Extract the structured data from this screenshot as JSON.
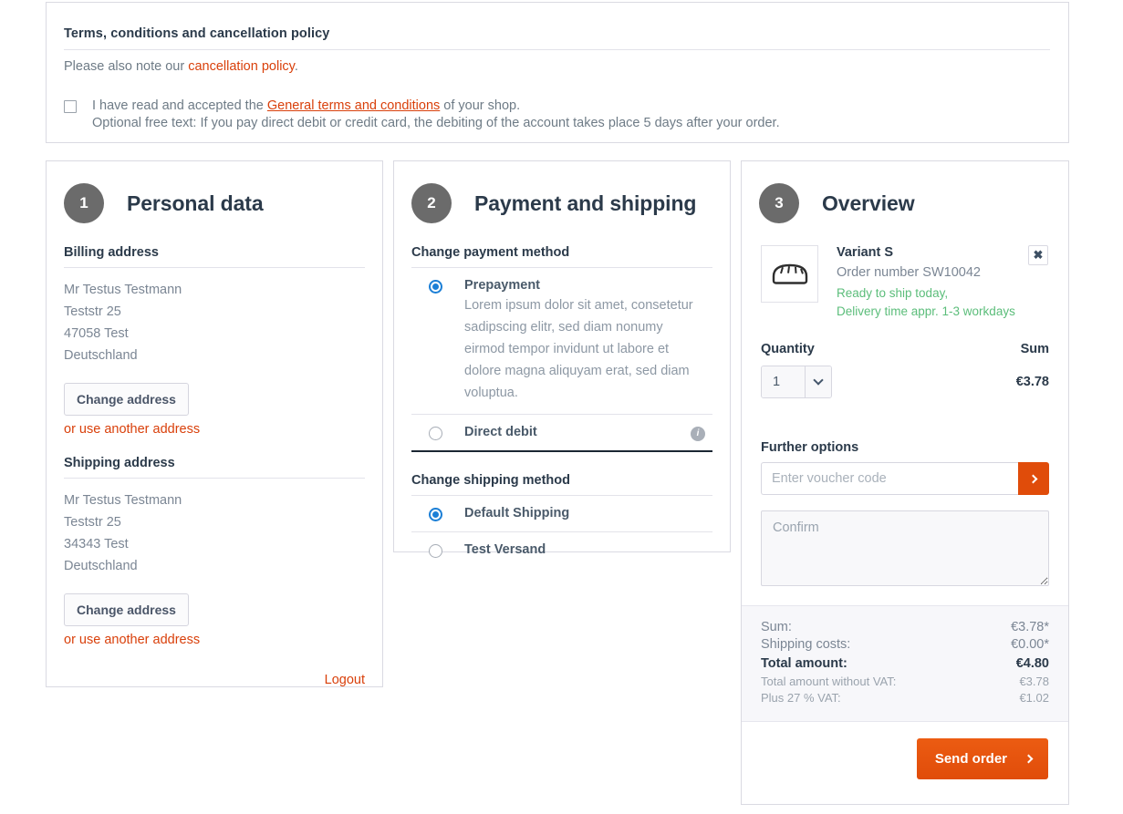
{
  "terms": {
    "title": "Terms, conditions and cancellation policy",
    "note_prefix": "Please also note our ",
    "note_link": "cancellation policy",
    "note_suffix": ".",
    "accept_prefix": "I have read and accepted the ",
    "accept_link": "General terms and conditions",
    "accept_suffix": " of your shop.",
    "optional_text": "Optional free text: If you pay direct debit or credit card, the debiting of the account takes place 5 days after your order.",
    "checkbox_checked": false
  },
  "personal": {
    "step": "1",
    "title": "Personal data",
    "billing_heading": "Billing address",
    "billing_lines": [
      "Mr Testus Testmann",
      "Teststr 25",
      "47058 Test",
      "Deutschland"
    ],
    "billing_change_label": "Change address",
    "billing_alt_label": "or use another address",
    "shipping_heading": "Shipping address",
    "shipping_lines": [
      "Mr Testus Testmann",
      "Teststr 25",
      "34343 Test",
      "Deutschland"
    ],
    "shipping_change_label": "Change address",
    "shipping_alt_label": "or use another address",
    "logout_label": "Logout"
  },
  "payment": {
    "step": "2",
    "title": "Payment and shipping",
    "payment_heading": "Change payment method",
    "methods": [
      {
        "label": "Prepayment",
        "desc": "Lorem ipsum dolor sit amet, consetetur sadipscing elitr, sed diam nonumy eirmod tempor invidunt ut labore et dolore magna aliquyam erat, sed diam voluptua.",
        "selected": true,
        "has_info": false
      },
      {
        "label": "Direct debit",
        "desc": "",
        "selected": false,
        "has_info": true,
        "info_glyph": "i"
      }
    ],
    "shipping_heading": "Change shipping method",
    "shipping_methods": [
      {
        "label": "Default Shipping",
        "selected": true
      },
      {
        "label": "Test Versand",
        "selected": false
      }
    ]
  },
  "overview": {
    "step": "3",
    "title": "Overview",
    "product": {
      "name": "Variant S",
      "order_number": "Order number SW10042",
      "ship_line1": "Ready to ship today,",
      "ship_line2": "Delivery time appr. 1-3 workdays",
      "remove_label": "✖"
    },
    "quantity_label": "Quantity",
    "sum_label": "Sum",
    "quantity_value": "1",
    "line_sum": "€3.78",
    "further_heading": "Further options",
    "voucher_placeholder": "Enter voucher code",
    "voucher_value": "",
    "confirm_placeholder": "Confirm",
    "confirm_value": "",
    "totals": [
      {
        "label": "Sum:",
        "value": "€3.78*",
        "style": "normal"
      },
      {
        "label": "Shipping costs:",
        "value": "€0.00*",
        "style": "normal"
      },
      {
        "label": "Total amount:",
        "value": "€4.80",
        "style": "bold"
      },
      {
        "label": "Total amount without VAT:",
        "value": "€3.78",
        "style": "small"
      },
      {
        "label": "Plus 27 % VAT:",
        "value": "€1.02",
        "style": "small"
      }
    ],
    "send_label": "Send order"
  },
  "colors": {
    "accent_orange": "#e04c0a",
    "link_red": "#d9400b",
    "radio_blue": "#1c7fd6",
    "green": "#5bbd7a",
    "step_circle": "#6b6b6b"
  }
}
